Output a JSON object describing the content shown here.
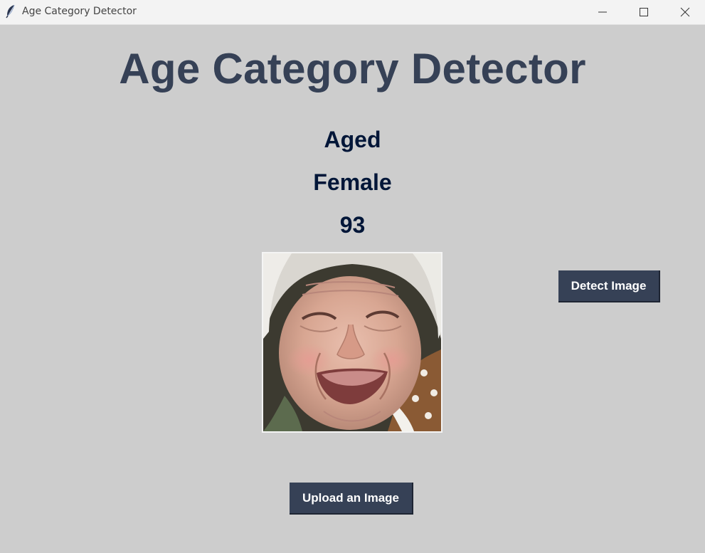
{
  "window": {
    "title": "Age Category Detector",
    "icon": "feather-icon",
    "controls": [
      "minimize-icon",
      "maximize-icon",
      "close-icon"
    ]
  },
  "main": {
    "heading": "Age Category Detector",
    "result": {
      "category": "Aged",
      "gender": "Female",
      "age": "93"
    },
    "uploaded_image": "elderly-woman-smiling-photo",
    "detect_button": "Detect Image",
    "upload_button": "Upload an Image"
  },
  "colors": {
    "background": "#cdcdcd",
    "heading": "#364156",
    "result_text": "#011638",
    "button_bg": "#364156",
    "button_text": "#ffffff"
  }
}
